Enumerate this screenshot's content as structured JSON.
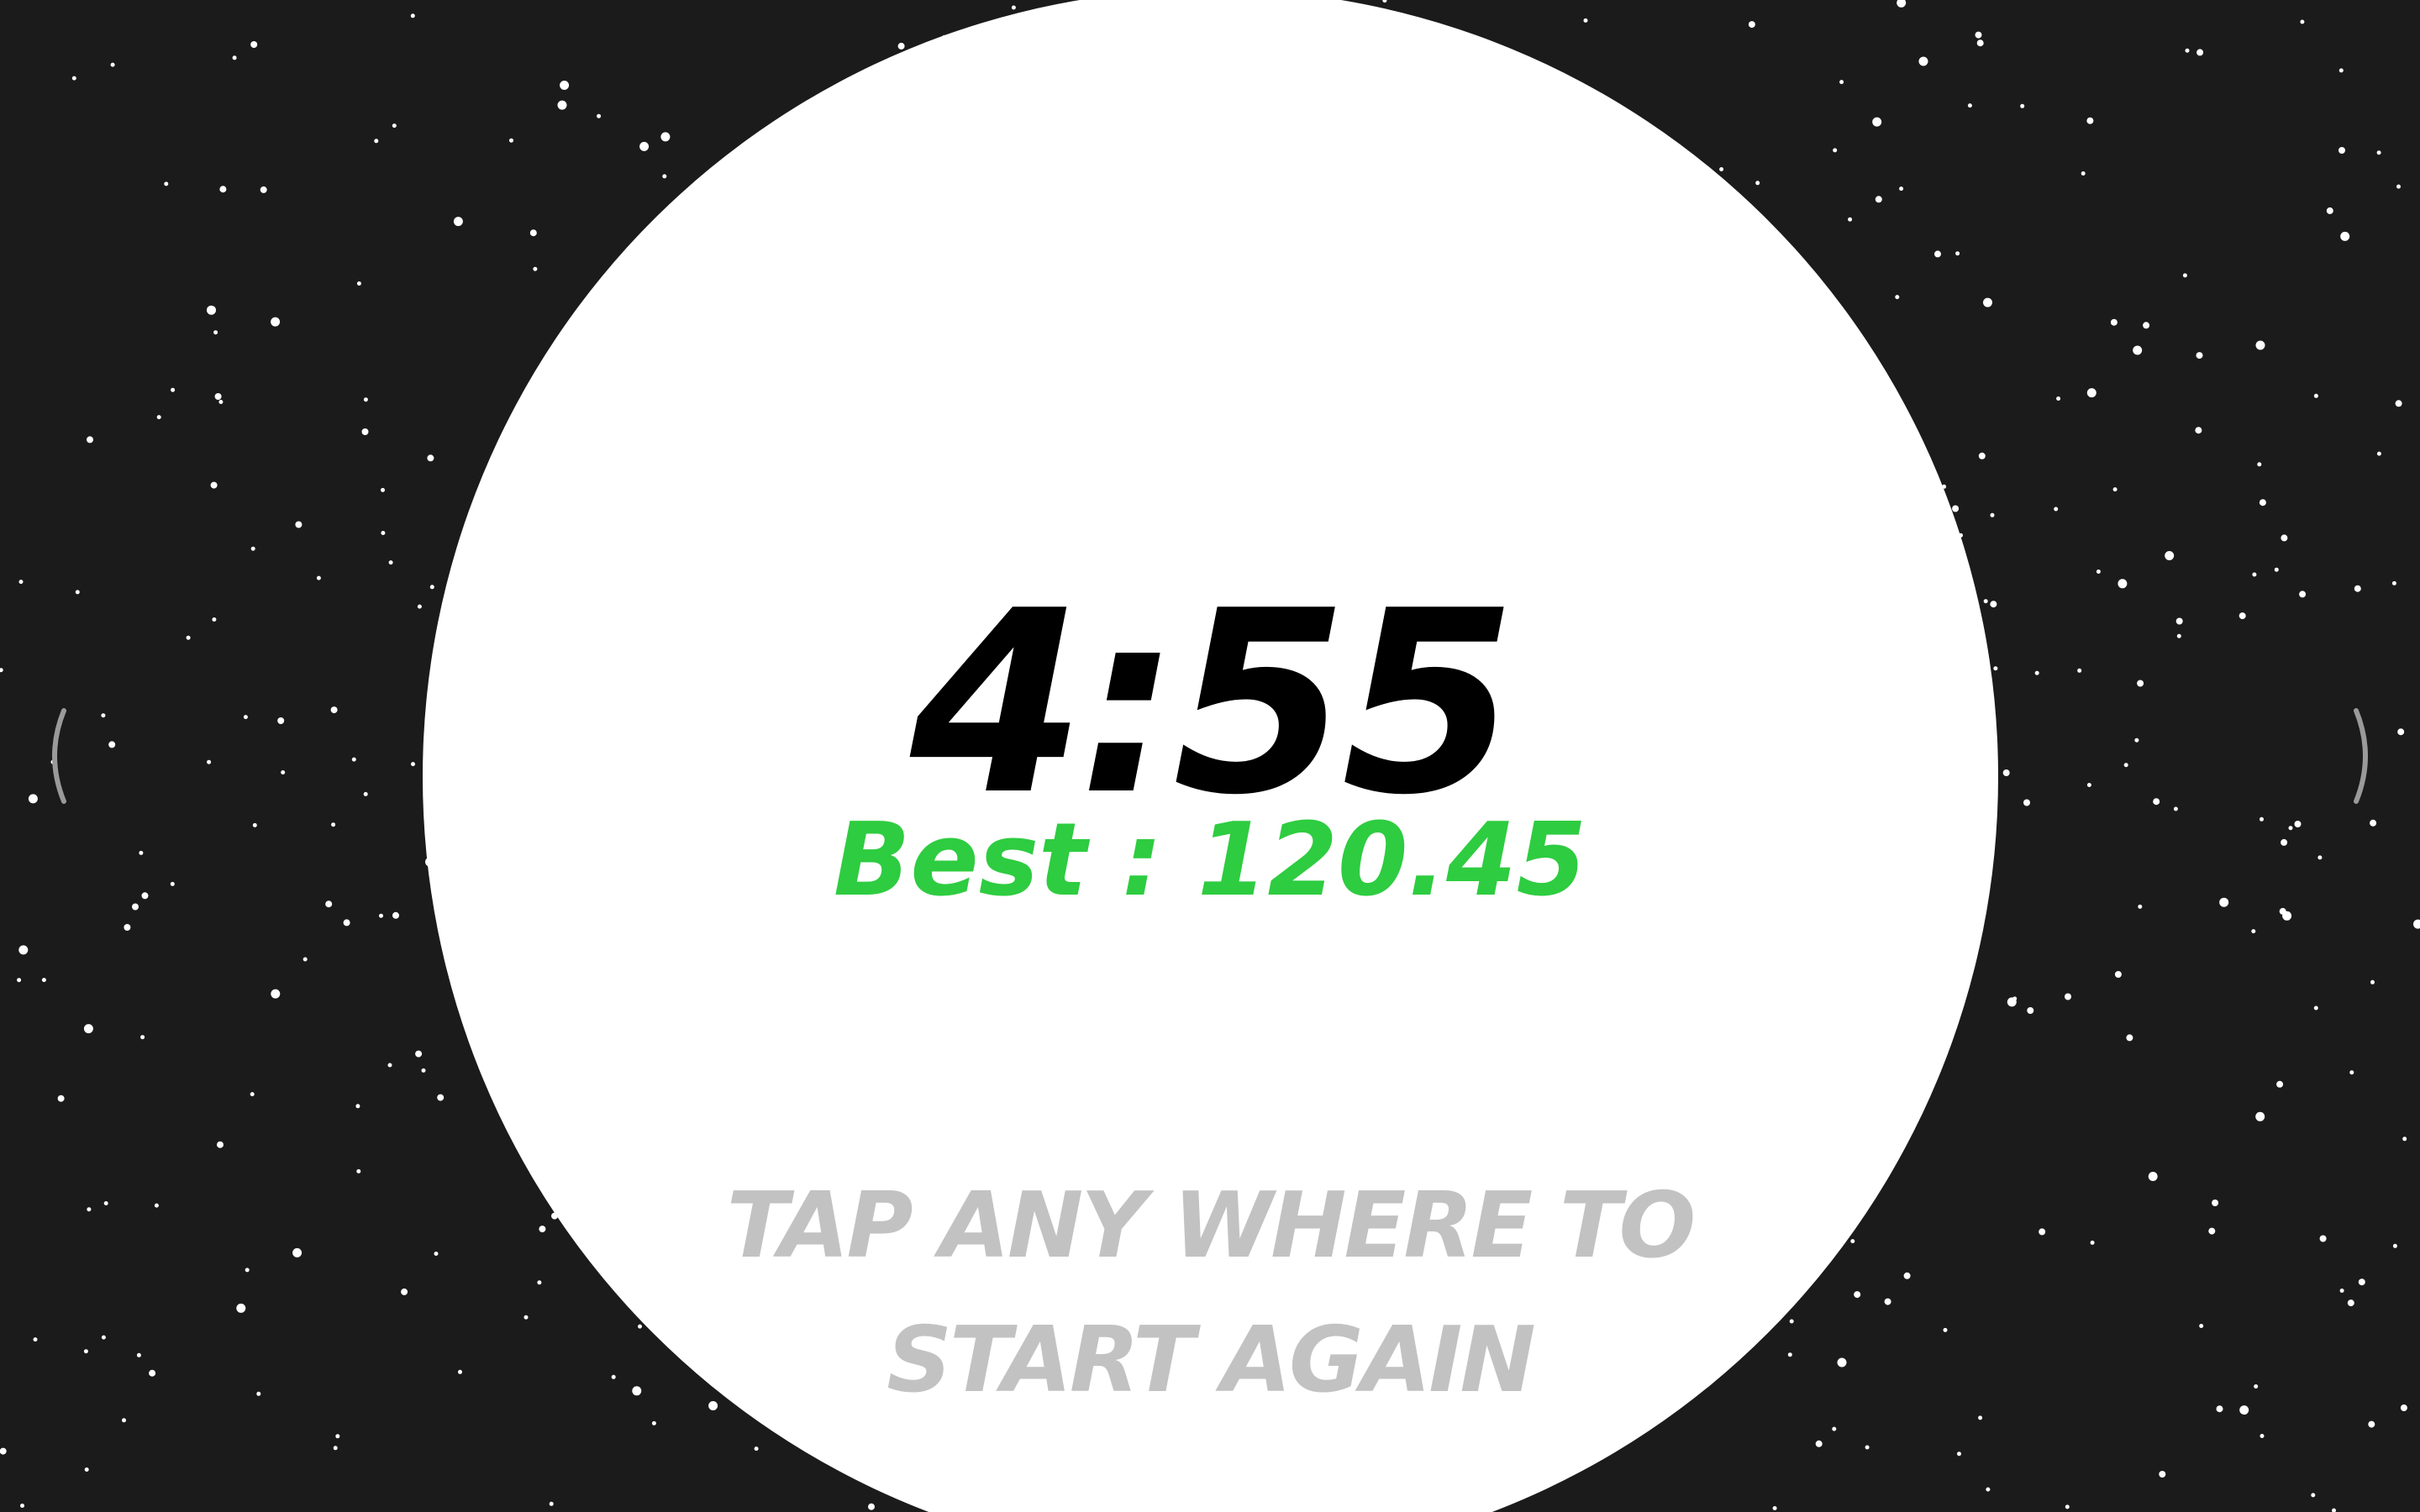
{
  "game": {
    "timer": "4:55",
    "best_label": "Best :",
    "best_value": "120.45",
    "restart_line1": "TAP ANY WHERE TO",
    "restart_line2": "START AGAIN"
  },
  "colors": {
    "background": "#1b1b1b",
    "disc": "#ffffff",
    "timer": "#000000",
    "best": "#2ecc40",
    "prompt": "#c2c2c2",
    "stars": "#ffffff",
    "edge_brackets": "#9a9a9a"
  },
  "icons": {
    "left_edge": "left-bracket-arc-icon",
    "right_edge": "right-bracket-arc-icon"
  }
}
